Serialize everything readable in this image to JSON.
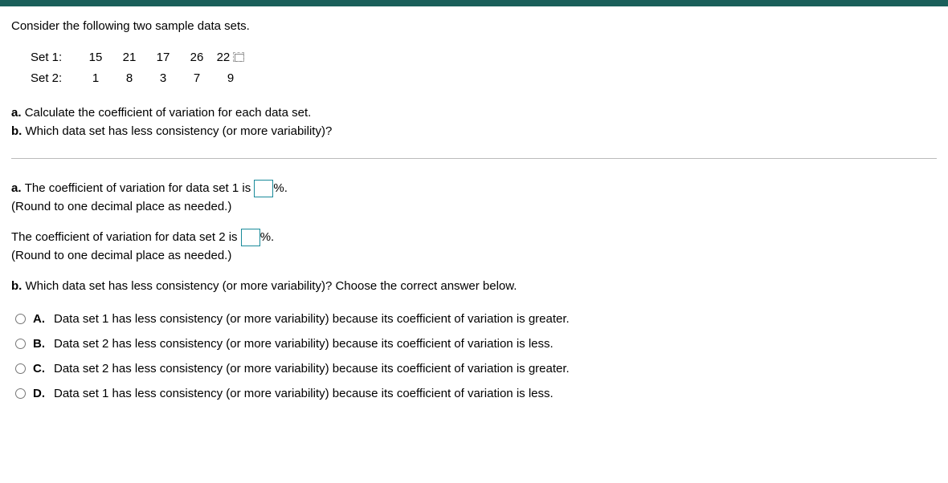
{
  "intro": "Consider the following two sample data sets.",
  "sets": {
    "set1": {
      "label": "Set 1:",
      "values": [
        "15",
        "21",
        "17",
        "26",
        "22"
      ]
    },
    "set2": {
      "label": "Set 2:",
      "values": [
        "1",
        "8",
        "3",
        "7",
        "9"
      ]
    }
  },
  "questions": {
    "a_prefix": "a. ",
    "a_text": "Calculate the coefficient of variation for each data set.",
    "b_prefix": "b. ",
    "b_text": "Which data set has less consistency (or more variability)?"
  },
  "answers": {
    "a_lead_prefix": "a. ",
    "a_lead": "The coefficient of variation for data set 1 is ",
    "a_suffix": "%.",
    "a_hint": "(Round to one decimal place as needed.)",
    "set2_lead": "The coefficient of variation for data set 2 is ",
    "set2_suffix": "%.",
    "set2_hint": "(Round to one decimal place as needed.)",
    "b_lead_prefix": "b. ",
    "b_lead": "Which data set has less consistency (or more variability)? Choose the correct answer below."
  },
  "options": {
    "A": {
      "label": "A.",
      "text": "Data set 1 has less consistency (or more variability) because its coefficient of variation is greater."
    },
    "B": {
      "label": "B.",
      "text": "Data set 2 has less consistency (or more variability) because its coefficient of variation is less."
    },
    "C": {
      "label": "C.",
      "text": "Data set 2 has less consistency (or more variability) because its coefficient of variation is greater."
    },
    "D": {
      "label": "D.",
      "text": "Data set 1 has less consistency (or more variability) because its coefficient of variation is less."
    }
  }
}
